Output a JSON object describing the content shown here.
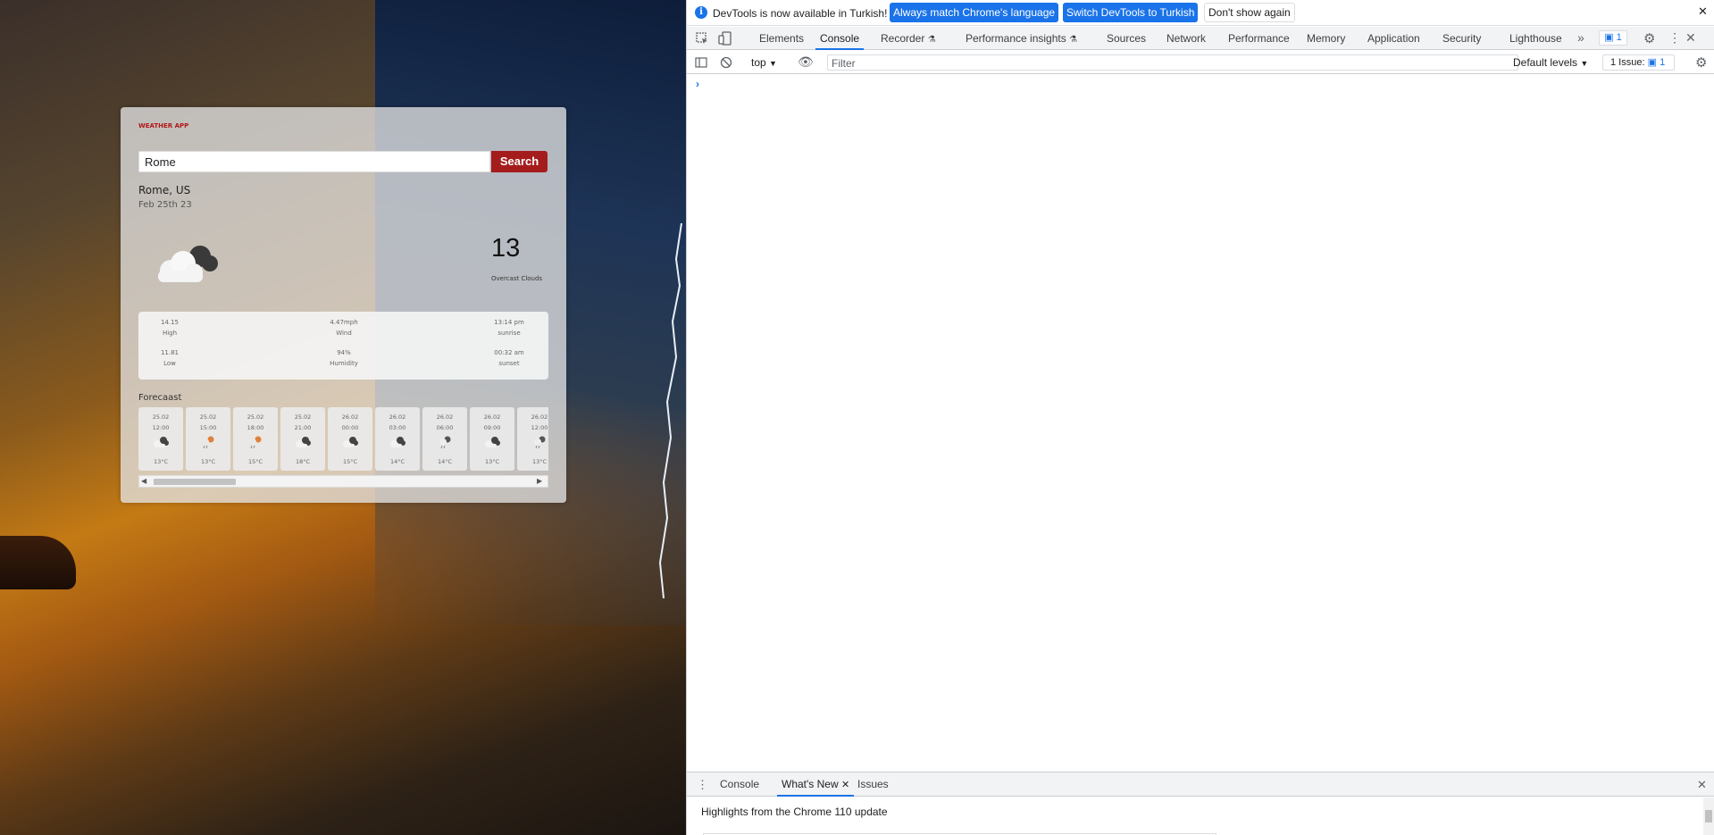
{
  "weather": {
    "app_title": "WEATHER APP",
    "search_value": "Rome",
    "search_label": "Search",
    "city": "Rome, US",
    "date": "Feb 25th 23",
    "temp": "13",
    "description": "Overcast Clouds",
    "details": {
      "high_value": "14.15",
      "high_label": "High",
      "wind_value": "4.47mph",
      "wind_label": "Wind",
      "sunrise_value": "13:14 pm",
      "sunrise_label": "sunrise",
      "low_value": "11.81",
      "low_label": "Low",
      "humidity_value": "94%",
      "humidity_label": "Humidity",
      "sunset_value": "00:32 am",
      "sunset_label": "sunset"
    },
    "forecast_title": "Forecaast",
    "forecast": [
      {
        "date": "25.02",
        "time": "12:00",
        "temp": "13°C",
        "icon": "overcast-clouds-icon"
      },
      {
        "date": "25.02",
        "time": "15:00",
        "temp": "13°C",
        "icon": "sun-rain-icon"
      },
      {
        "date": "25.02",
        "time": "18:00",
        "temp": "15°C",
        "icon": "sun-rain-icon"
      },
      {
        "date": "25.02",
        "time": "21:00",
        "temp": "18°C",
        "icon": "overcast-clouds-icon"
      },
      {
        "date": "26.02",
        "time": "00:00",
        "temp": "15°C",
        "icon": "overcast-clouds-icon"
      },
      {
        "date": "26.02",
        "time": "03:00",
        "temp": "14°C",
        "icon": "overcast-clouds-icon"
      },
      {
        "date": "26.02",
        "time": "06:00",
        "temp": "14°C",
        "icon": "cloud-rain-icon"
      },
      {
        "date": "26.02",
        "time": "09:00",
        "temp": "13°C",
        "icon": "overcast-clouds-icon"
      },
      {
        "date": "26.02",
        "time": "12:00",
        "temp": "13°C",
        "icon": "cloud-rain-icon"
      }
    ]
  },
  "devtools": {
    "info_text": "DevTools is now available in Turkish!",
    "btn_match": "Always match Chrome's language",
    "btn_switch": "Switch DevTools to Turkish",
    "btn_dont": "Don't show again",
    "tabs": [
      "Elements",
      "Console",
      "Recorder",
      "Performance insights",
      "Sources",
      "Network",
      "Performance",
      "Memory",
      "Application",
      "Security",
      "Lighthouse"
    ],
    "issues_count": "1",
    "context": "top",
    "filter_placeholder": "Filter",
    "default_levels": "Default levels",
    "issue_counter": "1 Issue:",
    "issue_counter_num": "1",
    "drawer_tabs": [
      "Console",
      "What's New",
      "Issues"
    ],
    "whats_new_text": "Highlights from the Chrome 110 update"
  },
  "colors": {
    "accent": "#1a73e8",
    "search_button": "#a51c1c",
    "app_title": "#b01818"
  }
}
